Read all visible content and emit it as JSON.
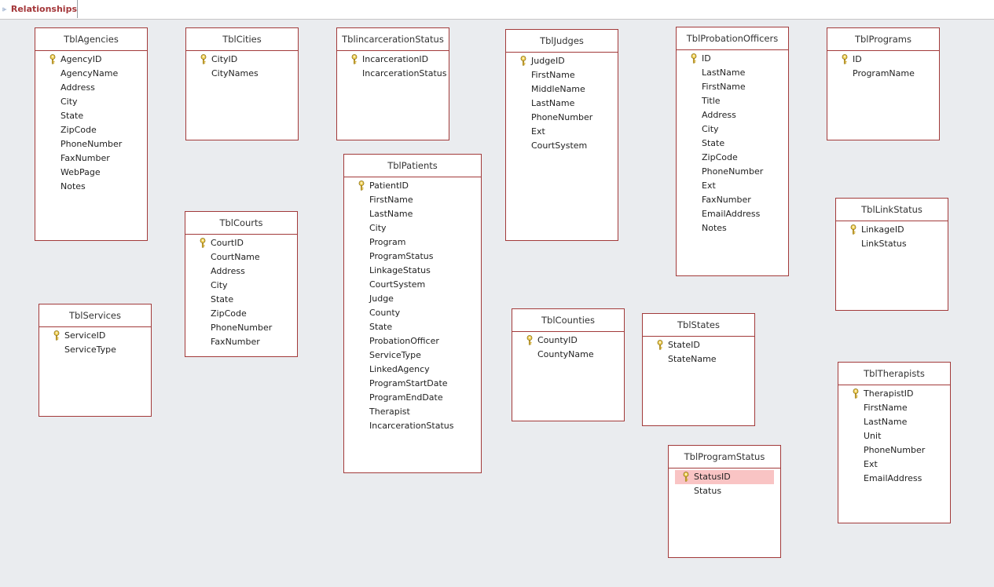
{
  "tab": {
    "label": "Relationships",
    "icon": "relationships-icon"
  },
  "colors": {
    "border": "#a23a3a",
    "tab_text": "#a4373a",
    "selected_row": "#f9c4c4",
    "background": "#eaecef"
  },
  "tables": [
    {
      "name": "TblAgencies",
      "fields": [
        {
          "label": "AgencyID",
          "key": true
        },
        {
          "label": "AgencyName"
        },
        {
          "label": "Address"
        },
        {
          "label": "City"
        },
        {
          "label": "State"
        },
        {
          "label": "ZipCode"
        },
        {
          "label": "PhoneNumber"
        },
        {
          "label": "FaxNumber"
        },
        {
          "label": "WebPage"
        },
        {
          "label": "Notes"
        }
      ]
    },
    {
      "name": "TblCities",
      "fields": [
        {
          "label": "CityID",
          "key": true
        },
        {
          "label": "CityNames"
        }
      ]
    },
    {
      "name": "TblincarcerationStatus",
      "fields": [
        {
          "label": "IncarcerationID",
          "key": true
        },
        {
          "label": "IncarcerationStatus"
        }
      ]
    },
    {
      "name": "TblJudges",
      "fields": [
        {
          "label": "JudgeID",
          "key": true
        },
        {
          "label": "FirstName"
        },
        {
          "label": "MiddleName"
        },
        {
          "label": "LastName"
        },
        {
          "label": "PhoneNumber"
        },
        {
          "label": "Ext"
        },
        {
          "label": "CourtSystem"
        }
      ]
    },
    {
      "name": "TblProbationOfficers",
      "fields": [
        {
          "label": "ID",
          "key": true
        },
        {
          "label": "LastName"
        },
        {
          "label": "FirstName"
        },
        {
          "label": "Title"
        },
        {
          "label": "Address"
        },
        {
          "label": "City"
        },
        {
          "label": "State"
        },
        {
          "label": "ZipCode"
        },
        {
          "label": "PhoneNumber"
        },
        {
          "label": "Ext"
        },
        {
          "label": "FaxNumber"
        },
        {
          "label": "EmailAddress"
        },
        {
          "label": "Notes"
        }
      ]
    },
    {
      "name": "TblPrograms",
      "fields": [
        {
          "label": "ID",
          "key": true
        },
        {
          "label": "ProgramName"
        }
      ]
    },
    {
      "name": "TblPatients",
      "fields": [
        {
          "label": "PatientID",
          "key": true
        },
        {
          "label": "FirstName"
        },
        {
          "label": "LastName"
        },
        {
          "label": "City"
        },
        {
          "label": "Program"
        },
        {
          "label": "ProgramStatus"
        },
        {
          "label": "LinkageStatus"
        },
        {
          "label": "CourtSystem"
        },
        {
          "label": "Judge"
        },
        {
          "label": "County"
        },
        {
          "label": "State"
        },
        {
          "label": "ProbationOfficer"
        },
        {
          "label": "ServiceType"
        },
        {
          "label": "LinkedAgency"
        },
        {
          "label": "ProgramStartDate"
        },
        {
          "label": "ProgramEndDate"
        },
        {
          "label": "Therapist"
        },
        {
          "label": "IncarcerationStatus"
        }
      ]
    },
    {
      "name": "TblCourts",
      "fields": [
        {
          "label": "CourtID",
          "key": true
        },
        {
          "label": "CourtName"
        },
        {
          "label": "Address"
        },
        {
          "label": "City"
        },
        {
          "label": "State"
        },
        {
          "label": "ZipCode"
        },
        {
          "label": "PhoneNumber"
        },
        {
          "label": "FaxNumber"
        }
      ]
    },
    {
      "name": "TblLinkStatus",
      "fields": [
        {
          "label": "LinkageID",
          "key": true
        },
        {
          "label": "LinkStatus"
        }
      ]
    },
    {
      "name": "TblServices",
      "fields": [
        {
          "label": "ServiceID",
          "key": true
        },
        {
          "label": "ServiceType"
        }
      ]
    },
    {
      "name": "TblCounties",
      "fields": [
        {
          "label": "CountyID",
          "key": true
        },
        {
          "label": "CountyName"
        }
      ]
    },
    {
      "name": "TblStates",
      "fields": [
        {
          "label": "StateID",
          "key": true
        },
        {
          "label": "StateName"
        }
      ]
    },
    {
      "name": "TblTherapists",
      "fields": [
        {
          "label": "TherapistID",
          "key": true
        },
        {
          "label": "FirstName"
        },
        {
          "label": "LastName"
        },
        {
          "label": "Unit"
        },
        {
          "label": "PhoneNumber"
        },
        {
          "label": "Ext"
        },
        {
          "label": "EmailAddress"
        }
      ]
    },
    {
      "name": "TblProgramStatus",
      "fields": [
        {
          "label": "StatusID",
          "key": true,
          "selected": true
        },
        {
          "label": "Status"
        }
      ]
    }
  ]
}
